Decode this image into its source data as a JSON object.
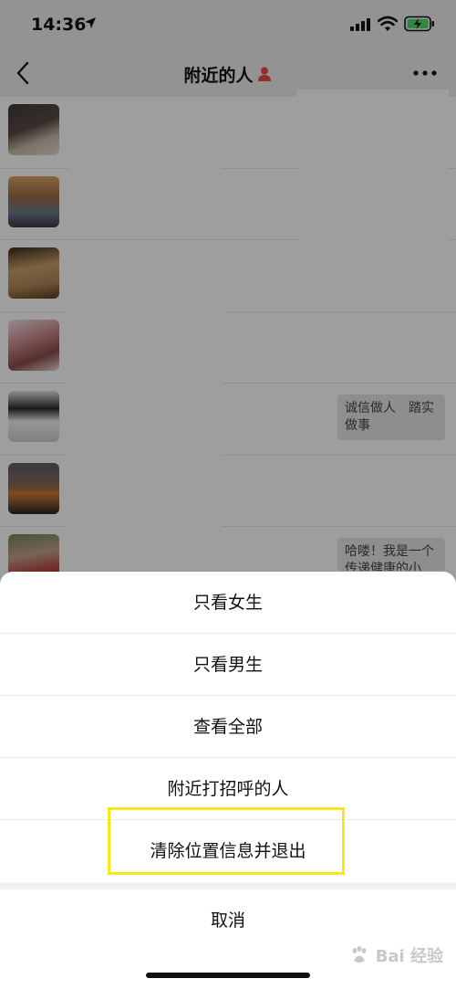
{
  "status_bar": {
    "time": "14:36"
  },
  "nav": {
    "title": "附近的人"
  },
  "list": {
    "bubbles": [
      {
        "text": "诚信做人　踏实做事"
      },
      {
        "text": "哈喽！我是一个传递健康的小"
      }
    ]
  },
  "action_sheet": {
    "options": [
      {
        "label": "只看女生"
      },
      {
        "label": "只看男生"
      },
      {
        "label": "查看全部"
      },
      {
        "label": "附近打招呼的人"
      },
      {
        "label": "清除位置信息并退出"
      }
    ],
    "cancel_label": "取消"
  },
  "watermark": {
    "text": "Bai 经验"
  },
  "colors": {
    "highlight": "#f7e81c",
    "battery_charging": "#4cd964",
    "person_icon": "#e74c3c"
  }
}
